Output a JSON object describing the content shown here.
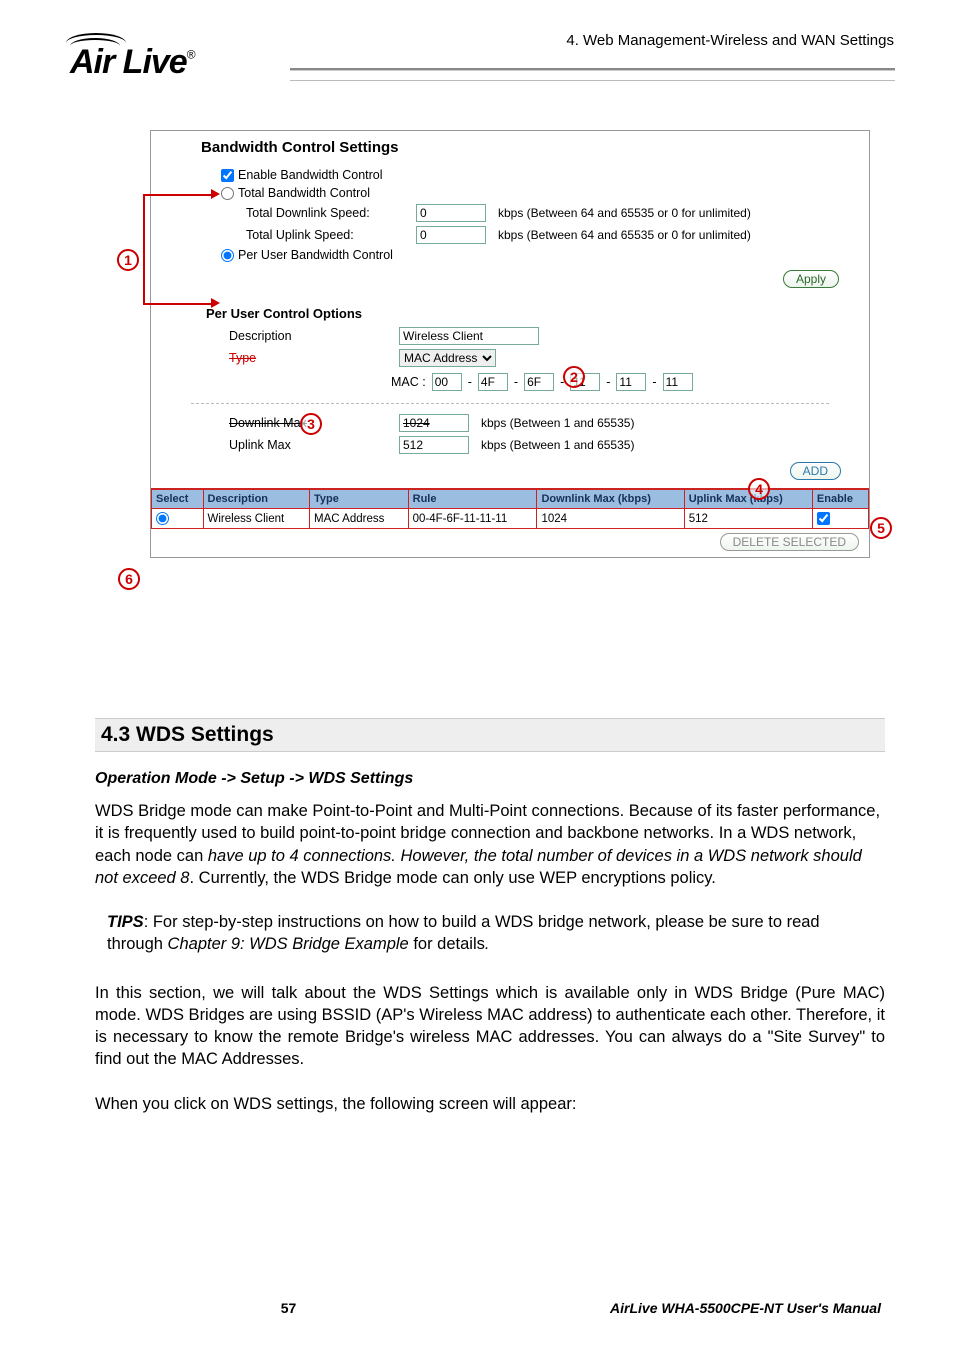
{
  "header": {
    "breadcrumb": "4. Web Management-Wireless and WAN Settings",
    "logo_text": "Air Live",
    "logo_reg": "®"
  },
  "bw": {
    "title": "Bandwidth Control Settings",
    "enable_label": "Enable Bandwidth Control",
    "total_label": "Total Bandwidth Control",
    "total_down_label": "Total Downlink Speed:",
    "total_up_label": "Total Uplink Speed:",
    "total_down_val": "0",
    "total_up_val": "0",
    "total_hint": "kbps (Between 64 and 65535 or 0 for unlimited)",
    "peruser_label": "Per User Bandwidth Control",
    "apply": "Apply",
    "puc_title": "Per User Control Options",
    "desc_label": "Description",
    "desc_val": "Wireless Client",
    "type_label": "Type",
    "type_val": "MAC Address",
    "mac_prefix": "MAC :",
    "mac": [
      "00",
      "4F",
      "6F",
      "11",
      "11",
      "11"
    ],
    "down_label": "Downlink Max",
    "down_val": "1024",
    "up_label": "Uplink Max",
    "up_val": "512",
    "ul_hint": "kbps (Between 1 and 65535)",
    "add": "ADD",
    "delete": "DELETE SELECTED",
    "th": {
      "select": "Select",
      "desc": "Description",
      "type": "Type",
      "rule": "Rule",
      "down": "Downlink Max (kbps)",
      "up": "Uplink Max (kbps)",
      "enable": "Enable"
    },
    "rows": [
      {
        "desc": "Wireless Client",
        "type": "MAC Address",
        "rule": "00-4F-6F-11-11-11",
        "down": "1024",
        "up": "512"
      }
    ]
  },
  "section": {
    "heading": "4.3 WDS  Settings",
    "opmode": "Operation Mode -> Setup -> WDS Settings",
    "p1a": "WDS Bridge mode can make Point-to-Point and Multi-Point connections.    Because of its faster performance, it is frequently used to build point-to-point bridge connection and backbone networks.    In a WDS network, each node can ",
    "p1b_i": "have up to 4 connections. However, the total number of devices in a WDS network should not exceed 8",
    "p1c": ".    Currently, the WDS Bridge mode can only use WEP encryptions policy.",
    "tips_label": "TIPS",
    "tips_a": ":   For step-by-step instructions on how to build a WDS bridge network, please be sure to read through ",
    "tips_b_i": "Chapter 9: WDS Bridge Example",
    "tips_c": " for details",
    "tips_d_i": ".",
    "p2": "In this section, we will talk about the WDS Settings which is available only in WDS Bridge (Pure MAC) mode.  WDS Bridges are using BSSID (AP's Wireless MAC address) to authenticate each other.   Therefore, it is necessary to know the remote Bridge's wireless MAC addresses.    You can always do a \"Site Survey\" to find out the MAC Addresses.",
    "p3": "When you click on WDS settings, the following screen will appear:"
  },
  "footer": {
    "page": "57",
    "manual": "AirLive WHA-5500CPE-NT User's Manual"
  }
}
